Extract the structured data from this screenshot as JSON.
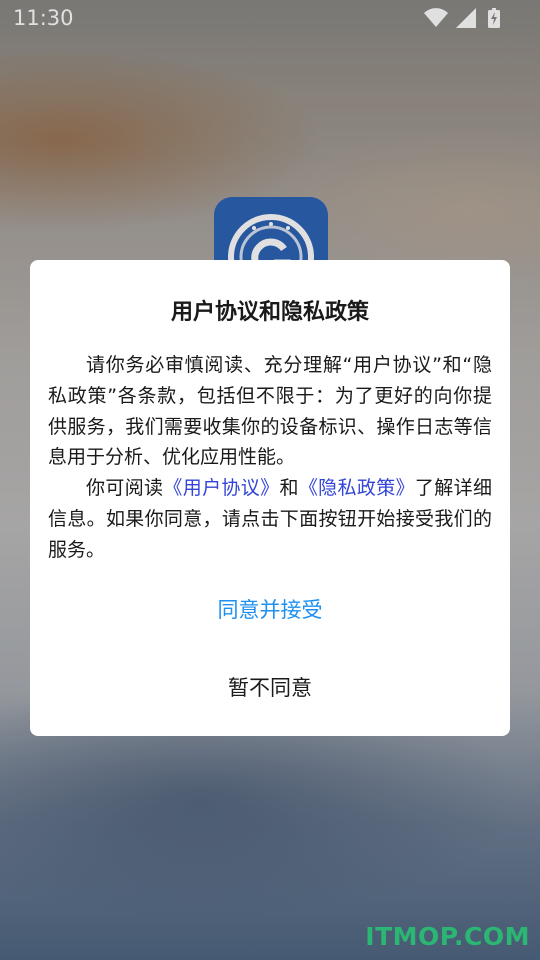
{
  "status_bar": {
    "time": "11:30",
    "icons": [
      "wifi-icon",
      "cellular-signal-icon",
      "battery-charging-icon"
    ]
  },
  "app_icon": {
    "name": "app-logo-icon",
    "color": "#2d64b4"
  },
  "dialog": {
    "title": "用户协议和隐私政策",
    "paragraph1": "请你务必审慎阅读、充分理解“用户协议”和“隐私政策”各条款，包括但不限于：为了更好的向你提供服务，我们需要收集你的设备标识、操作日志等信息用于分析、优化应用性能。",
    "paragraph2_prefix": "你可阅读",
    "user_agreement_link": "《用户协议》",
    "paragraph2_and": "和",
    "privacy_policy_link": "《隐私政策》",
    "paragraph2_suffix": "了解详细信息。如果你同意，请点击下面按钮开始接受我们的服务。",
    "agree_button": "同意并接受",
    "disagree_button": "暂不同意"
  },
  "watermark": "ITMOP.COM",
  "colors": {
    "agree_button": "#1e90f0",
    "link": "#3344d6",
    "watermark": "#2bb673",
    "dialog_background": "#ffffff"
  }
}
